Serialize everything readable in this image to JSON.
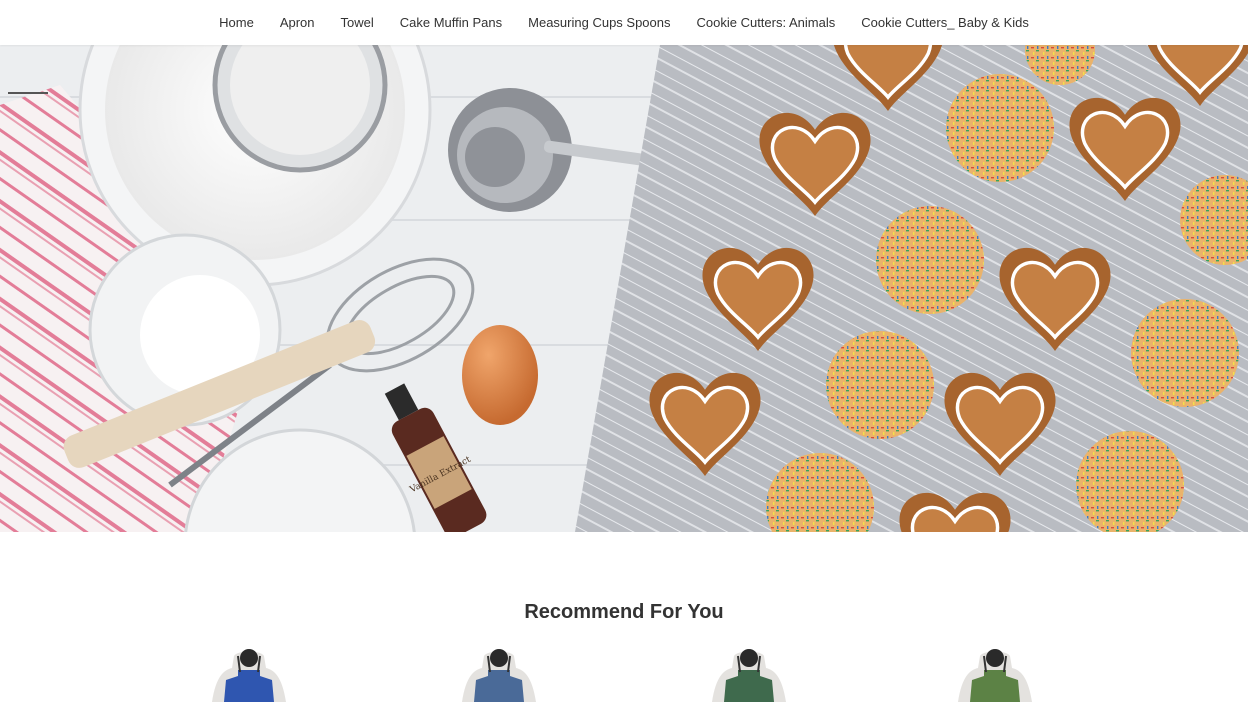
{
  "nav": {
    "items": [
      "Home",
      "Apron",
      "Towel",
      "Cake Muffin Pans",
      "Measuring Cups Spoons",
      "Cookie Cutters: Animals",
      "Cookie Cutters_ Baby & Kids"
    ]
  },
  "hero": {
    "label_text": "Vanilla Extract"
  },
  "recommend": {
    "title": "Recommend For You",
    "products": [
      {
        "name": "apron-blue",
        "color": "#2f56b0"
      },
      {
        "name": "apron-denim",
        "color": "#4a6a98"
      },
      {
        "name": "apron-forest-green",
        "color": "#3f6a4d"
      },
      {
        "name": "apron-olive-green",
        "color": "#5c8245"
      }
    ]
  }
}
